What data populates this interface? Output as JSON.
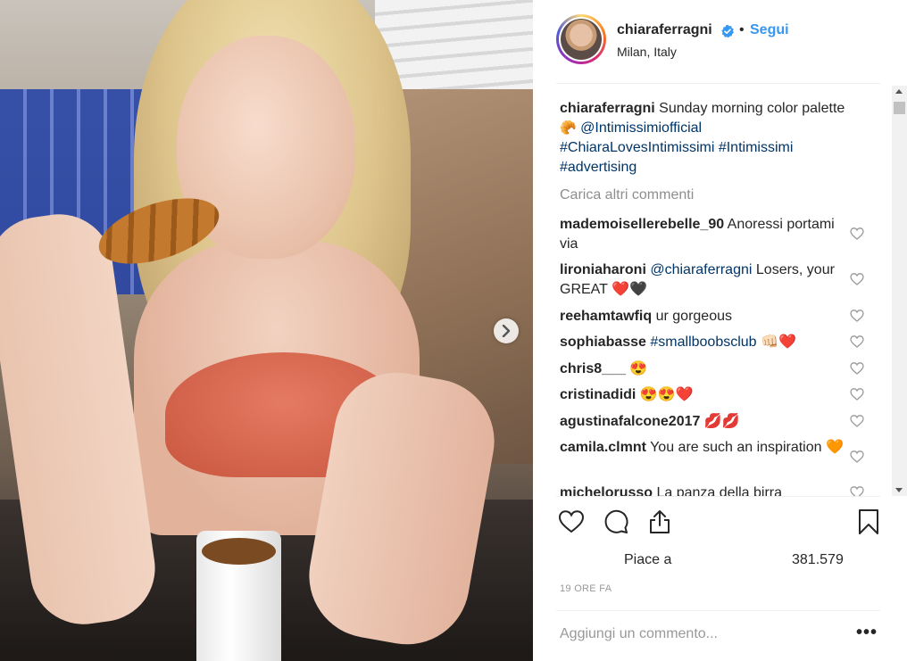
{
  "post": {
    "username": "chiaraferragni",
    "follow_separator": "•",
    "follow_label": "Segui",
    "location": "Milan, Italy",
    "verified_icon": "verified-badge-icon"
  },
  "caption": {
    "username": "chiaraferragni",
    "text": "Sunday morning color palette",
    "emoji": "🥐",
    "mention": "@Intimissimiofficial",
    "hashtags": "#ChiaraLovesIntimissimi #Intimissimi #advertising"
  },
  "load_more": "Carica altri commenti",
  "comments": [
    {
      "username": "mademoisellerebelle_90",
      "text": "Anoressi portami via"
    },
    {
      "username": "lironiaharoni",
      "mention": "@chiaraferragni",
      "text": "Losers, your GREAT ❤️🖤"
    },
    {
      "username": "reehamtawfiq",
      "text": "ur gorgeous"
    },
    {
      "username": "sophiabasse",
      "mention": "#smallboobsclub",
      "text": "👊🏻❤️"
    },
    {
      "username": "chris8___",
      "text": "😍"
    },
    {
      "username": "cristinadidi",
      "text": "😍😍❤️"
    },
    {
      "username": "agustinafalcone2017",
      "text": "💋💋"
    },
    {
      "username": "camila.clmnt",
      "text": "You are such an inspiration 🧡"
    },
    {
      "username": "michelorusso",
      "text": "La panza della birra"
    }
  ],
  "actions": {
    "like_icon": "heart-icon",
    "comment_icon": "comment-bubble-icon",
    "share_icon": "share-icon",
    "save_icon": "bookmark-icon",
    "likes_label": "Piace a",
    "likes_count": "381.579"
  },
  "timestamp": "19 ORE FA",
  "add_comment": {
    "placeholder": "Aggiungi un commento...",
    "more_label": "•••"
  },
  "colors": {
    "link": "#003569",
    "follow": "#3897f0",
    "muted": "#8e8e8e"
  }
}
